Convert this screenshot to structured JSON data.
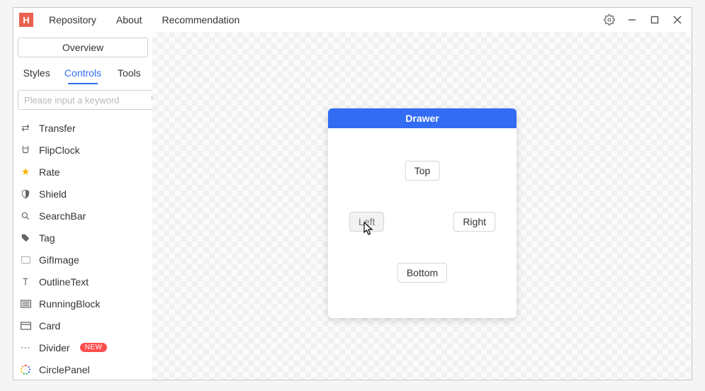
{
  "menu": {
    "items": [
      "Repository",
      "About",
      "Recommendation"
    ]
  },
  "windowControls": {
    "settings": "settings",
    "minimize": "minimize",
    "maximize": "maximize",
    "close": "close"
  },
  "sidebar": {
    "overview_label": "Overview",
    "tabs": [
      "Styles",
      "Controls",
      "Tools"
    ],
    "active_tab": 1,
    "search_placeholder": "Please input a keyword",
    "controls": [
      {
        "icon": "transfer-icon",
        "label": "Transfer"
      },
      {
        "icon": "flipclock-icon",
        "label": "FlipClock"
      },
      {
        "icon": "star-icon",
        "label": "Rate"
      },
      {
        "icon": "shield-icon",
        "label": "Shield"
      },
      {
        "icon": "search-icon",
        "label": "SearchBar"
      },
      {
        "icon": "tag-icon",
        "label": "Tag"
      },
      {
        "icon": "gif-icon",
        "label": "GifImage"
      },
      {
        "icon": "outline-text-icon",
        "label": "OutlineText"
      },
      {
        "icon": "running-block-icon",
        "label": "RunningBlock"
      },
      {
        "icon": "card-icon",
        "label": "Card"
      },
      {
        "icon": "divider-icon",
        "label": "Divider",
        "badge": "NEW"
      },
      {
        "icon": "circle-panel-icon",
        "label": "CirclePanel"
      }
    ]
  },
  "panel": {
    "title": "Drawer",
    "buttons": {
      "top": "Top",
      "left": "Left",
      "right": "Right",
      "bottom": "Bottom"
    },
    "hovered": "left"
  },
  "colors": {
    "accent": "#326cf3",
    "logo": "#e8624f",
    "badge": "#ff4d4f"
  }
}
